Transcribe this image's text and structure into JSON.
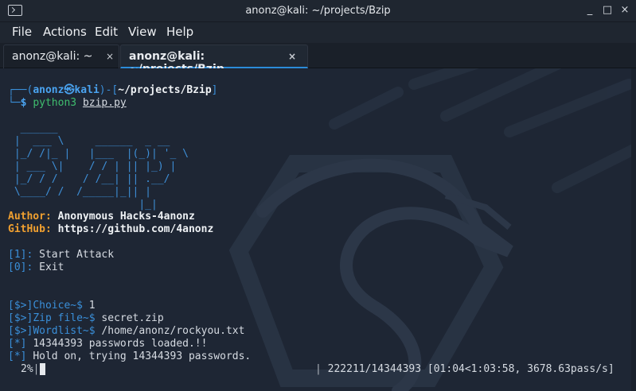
{
  "window": {
    "title": "anonz@kali: ~/projects/Bzip",
    "controls": {
      "minimize": "_",
      "maximize": "□",
      "close": "×"
    }
  },
  "menu": [
    "File",
    "Actions",
    "Edit",
    "View",
    "Help"
  ],
  "tabs": [
    {
      "label": "anonz@kali: ~",
      "active": false
    },
    {
      "label": "anonz@kali: ~/projects/Bzip",
      "active": true
    }
  ],
  "tab_close_glyph": "×",
  "terminal": {
    "prompt": {
      "corner_top": "┌──(",
      "user": "anonz",
      "at": "㉿",
      "host": "kali",
      "mid": ")-[",
      "path": "~/projects/Bzip",
      "end": "]",
      "corner_bottom": "└─",
      "dollar": "$",
      "cmd": "python3",
      "arg": "bzip.py"
    },
    "ascii_art": [
      "  ______",
      " |  ___ \\     ______  _ __",
      " |_/ /|_ |   |___  |(_)| '_ \\",
      " | ___ \\|    / / | || |_) |",
      " |_/ / /    / /__| || .__/",
      " \\____/ /  /_____|_|| |",
      "                     |_|"
    ],
    "author_label": "Author:",
    "author_value": "Anonymous Hacks-4anonz",
    "github_label": "GitHub:",
    "github_value": "https://github.com/4anonz",
    "menu_options": [
      {
        "key": "[1]:",
        "label": "Start Attack"
      },
      {
        "key": "[0]:",
        "label": "Exit"
      }
    ],
    "inputs": [
      {
        "prefix": "[$>]",
        "name": "Choice~$",
        "value": "1"
      },
      {
        "prefix": "[$>]",
        "name": "Zip file~$",
        "value": "secret.zip"
      },
      {
        "prefix": "[$>]",
        "name": "Wordlist~$",
        "value": "/home/anonz/rockyou.txt"
      }
    ],
    "status": [
      {
        "marker": "[*]",
        "text": "14344393 passwords loaded.!!"
      },
      {
        "marker": "[*]",
        "text": "Hold on, trying 14344393 passwords."
      }
    ],
    "progress": {
      "percent_text": "2%",
      "percent": 2,
      "sep": "|",
      "counts": "222211/14344393",
      "timing": "[01:04<1:03:58, 3678.63pass/s]"
    }
  }
}
